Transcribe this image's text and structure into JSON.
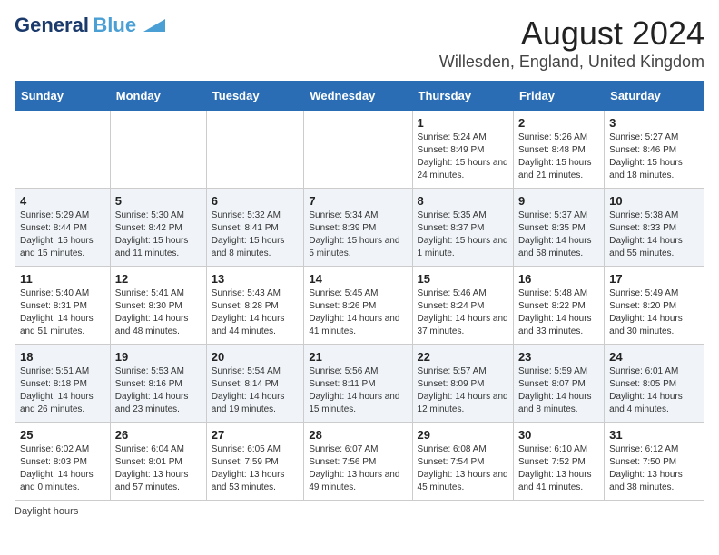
{
  "logo": {
    "line1": "General",
    "line2": "Blue",
    "arrow_color": "#4a9fd4"
  },
  "title": "August 2024",
  "subtitle": "Willesden, England, United Kingdom",
  "days_of_week": [
    "Sunday",
    "Monday",
    "Tuesday",
    "Wednesday",
    "Thursday",
    "Friday",
    "Saturday"
  ],
  "footnote": "Daylight hours",
  "weeks": [
    [
      {
        "day": "",
        "sunrise": "",
        "sunset": "",
        "daylight": ""
      },
      {
        "day": "",
        "sunrise": "",
        "sunset": "",
        "daylight": ""
      },
      {
        "day": "",
        "sunrise": "",
        "sunset": "",
        "daylight": ""
      },
      {
        "day": "",
        "sunrise": "",
        "sunset": "",
        "daylight": ""
      },
      {
        "day": "1",
        "sunrise": "Sunrise: 5:24 AM",
        "sunset": "Sunset: 8:49 PM",
        "daylight": "Daylight: 15 hours and 24 minutes."
      },
      {
        "day": "2",
        "sunrise": "Sunrise: 5:26 AM",
        "sunset": "Sunset: 8:48 PM",
        "daylight": "Daylight: 15 hours and 21 minutes."
      },
      {
        "day": "3",
        "sunrise": "Sunrise: 5:27 AM",
        "sunset": "Sunset: 8:46 PM",
        "daylight": "Daylight: 15 hours and 18 minutes."
      }
    ],
    [
      {
        "day": "4",
        "sunrise": "Sunrise: 5:29 AM",
        "sunset": "Sunset: 8:44 PM",
        "daylight": "Daylight: 15 hours and 15 minutes."
      },
      {
        "day": "5",
        "sunrise": "Sunrise: 5:30 AM",
        "sunset": "Sunset: 8:42 PM",
        "daylight": "Daylight: 15 hours and 11 minutes."
      },
      {
        "day": "6",
        "sunrise": "Sunrise: 5:32 AM",
        "sunset": "Sunset: 8:41 PM",
        "daylight": "Daylight: 15 hours and 8 minutes."
      },
      {
        "day": "7",
        "sunrise": "Sunrise: 5:34 AM",
        "sunset": "Sunset: 8:39 PM",
        "daylight": "Daylight: 15 hours and 5 minutes."
      },
      {
        "day": "8",
        "sunrise": "Sunrise: 5:35 AM",
        "sunset": "Sunset: 8:37 PM",
        "daylight": "Daylight: 15 hours and 1 minute."
      },
      {
        "day": "9",
        "sunrise": "Sunrise: 5:37 AM",
        "sunset": "Sunset: 8:35 PM",
        "daylight": "Daylight: 14 hours and 58 minutes."
      },
      {
        "day": "10",
        "sunrise": "Sunrise: 5:38 AM",
        "sunset": "Sunset: 8:33 PM",
        "daylight": "Daylight: 14 hours and 55 minutes."
      }
    ],
    [
      {
        "day": "11",
        "sunrise": "Sunrise: 5:40 AM",
        "sunset": "Sunset: 8:31 PM",
        "daylight": "Daylight: 14 hours and 51 minutes."
      },
      {
        "day": "12",
        "sunrise": "Sunrise: 5:41 AM",
        "sunset": "Sunset: 8:30 PM",
        "daylight": "Daylight: 14 hours and 48 minutes."
      },
      {
        "day": "13",
        "sunrise": "Sunrise: 5:43 AM",
        "sunset": "Sunset: 8:28 PM",
        "daylight": "Daylight: 14 hours and 44 minutes."
      },
      {
        "day": "14",
        "sunrise": "Sunrise: 5:45 AM",
        "sunset": "Sunset: 8:26 PM",
        "daylight": "Daylight: 14 hours and 41 minutes."
      },
      {
        "day": "15",
        "sunrise": "Sunrise: 5:46 AM",
        "sunset": "Sunset: 8:24 PM",
        "daylight": "Daylight: 14 hours and 37 minutes."
      },
      {
        "day": "16",
        "sunrise": "Sunrise: 5:48 AM",
        "sunset": "Sunset: 8:22 PM",
        "daylight": "Daylight: 14 hours and 33 minutes."
      },
      {
        "day": "17",
        "sunrise": "Sunrise: 5:49 AM",
        "sunset": "Sunset: 8:20 PM",
        "daylight": "Daylight: 14 hours and 30 minutes."
      }
    ],
    [
      {
        "day": "18",
        "sunrise": "Sunrise: 5:51 AM",
        "sunset": "Sunset: 8:18 PM",
        "daylight": "Daylight: 14 hours and 26 minutes."
      },
      {
        "day": "19",
        "sunrise": "Sunrise: 5:53 AM",
        "sunset": "Sunset: 8:16 PM",
        "daylight": "Daylight: 14 hours and 23 minutes."
      },
      {
        "day": "20",
        "sunrise": "Sunrise: 5:54 AM",
        "sunset": "Sunset: 8:14 PM",
        "daylight": "Daylight: 14 hours and 19 minutes."
      },
      {
        "day": "21",
        "sunrise": "Sunrise: 5:56 AM",
        "sunset": "Sunset: 8:11 PM",
        "daylight": "Daylight: 14 hours and 15 minutes."
      },
      {
        "day": "22",
        "sunrise": "Sunrise: 5:57 AM",
        "sunset": "Sunset: 8:09 PM",
        "daylight": "Daylight: 14 hours and 12 minutes."
      },
      {
        "day": "23",
        "sunrise": "Sunrise: 5:59 AM",
        "sunset": "Sunset: 8:07 PM",
        "daylight": "Daylight: 14 hours and 8 minutes."
      },
      {
        "day": "24",
        "sunrise": "Sunrise: 6:01 AM",
        "sunset": "Sunset: 8:05 PM",
        "daylight": "Daylight: 14 hours and 4 minutes."
      }
    ],
    [
      {
        "day": "25",
        "sunrise": "Sunrise: 6:02 AM",
        "sunset": "Sunset: 8:03 PM",
        "daylight": "Daylight: 14 hours and 0 minutes."
      },
      {
        "day": "26",
        "sunrise": "Sunrise: 6:04 AM",
        "sunset": "Sunset: 8:01 PM",
        "daylight": "Daylight: 13 hours and 57 minutes."
      },
      {
        "day": "27",
        "sunrise": "Sunrise: 6:05 AM",
        "sunset": "Sunset: 7:59 PM",
        "daylight": "Daylight: 13 hours and 53 minutes."
      },
      {
        "day": "28",
        "sunrise": "Sunrise: 6:07 AM",
        "sunset": "Sunset: 7:56 PM",
        "daylight": "Daylight: 13 hours and 49 minutes."
      },
      {
        "day": "29",
        "sunrise": "Sunrise: 6:08 AM",
        "sunset": "Sunset: 7:54 PM",
        "daylight": "Daylight: 13 hours and 45 minutes."
      },
      {
        "day": "30",
        "sunrise": "Sunrise: 6:10 AM",
        "sunset": "Sunset: 7:52 PM",
        "daylight": "Daylight: 13 hours and 41 minutes."
      },
      {
        "day": "31",
        "sunrise": "Sunrise: 6:12 AM",
        "sunset": "Sunset: 7:50 PM",
        "daylight": "Daylight: 13 hours and 38 minutes."
      }
    ]
  ]
}
